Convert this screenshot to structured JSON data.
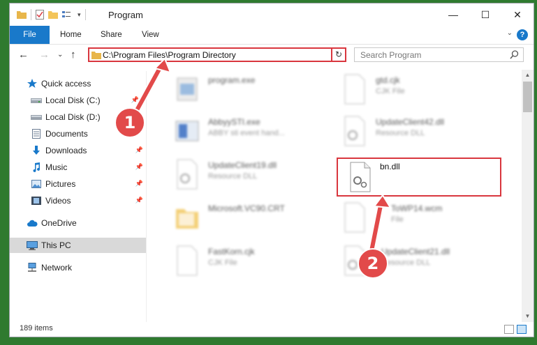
{
  "window": {
    "title": "Program",
    "minimize_glyph": "—",
    "maximize_glyph": "☐",
    "close_glyph": "✕"
  },
  "ribbon": {
    "tabs": [
      "File",
      "Home",
      "Share",
      "View"
    ],
    "help_glyph": "?",
    "collapse_glyph": "⌄"
  },
  "navbar": {
    "back_glyph": "←",
    "forward_glyph": "→",
    "recent_glyph": "⌄",
    "up_glyph": "↑",
    "address_path": "C:\\Program Files\\Program Directory",
    "address_dropdown_glyph": "⌄",
    "refresh_glyph": "↻",
    "search_placeholder": "Search Program"
  },
  "sidebar": {
    "items": [
      {
        "label": "Quick access",
        "icon": "star-icon"
      },
      {
        "label": "Local Disk (C:)",
        "icon": "drive-icon"
      },
      {
        "label": "Local Disk (D:)",
        "icon": "drive-icon"
      },
      {
        "label": "Documents",
        "icon": "documents-icon"
      },
      {
        "label": "Downloads",
        "icon": "download-icon"
      },
      {
        "label": "Music",
        "icon": "music-icon"
      },
      {
        "label": "Pictures",
        "icon": "pictures-icon"
      },
      {
        "label": "Videos",
        "icon": "videos-icon"
      },
      {
        "label": "OneDrive",
        "icon": "cloud-icon"
      },
      {
        "label": "This PC",
        "icon": "computer-icon"
      },
      {
        "label": "Network",
        "icon": "network-icon"
      }
    ]
  },
  "files": [
    {
      "name": "program.exe",
      "type": ""
    },
    {
      "name": "gtd.cjk",
      "type": "CJK File"
    },
    {
      "name": "AbbyySTI.exe",
      "type": "ABBY sti event hand..."
    },
    {
      "name": "UpdateClient42.dll",
      "type": "Resource DLL"
    },
    {
      "name": "UpdateClient19.dll",
      "type": "Resource DLL"
    },
    {
      "name": "bn.dll",
      "type": ""
    },
    {
      "name": "Microsoft.VC90.CRT",
      "type": ""
    },
    {
      "name": "ToWP14.wcm",
      "type": "File"
    },
    {
      "name": "FastKorn.cjk",
      "type": "CJK File"
    },
    {
      "name": "UpdateClient21.dll",
      "type": "Resource DLL"
    }
  ],
  "status": {
    "item_count": "189 items"
  },
  "annotations": [
    {
      "label": "1"
    },
    {
      "label": "2"
    }
  ],
  "colors": {
    "accent": "#1979ca",
    "highlight": "#d9363e",
    "selected_nav": "#d9d9d9"
  }
}
